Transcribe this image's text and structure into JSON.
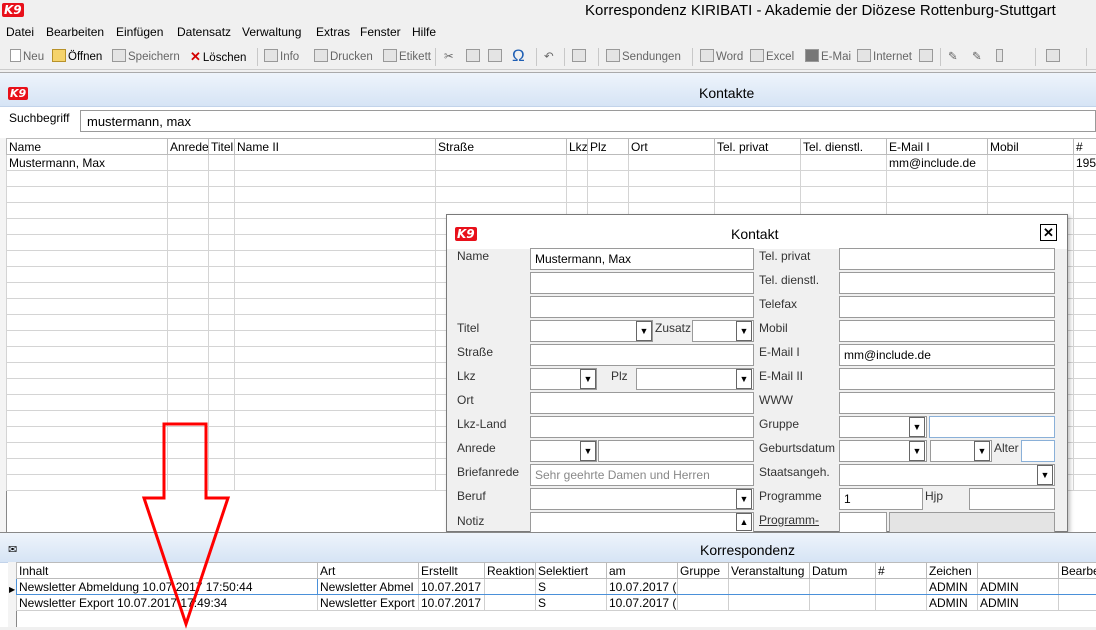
{
  "app": {
    "logo_text": "K9",
    "title": "Korrespondenz KIRIBATI - Akademie der Diözese Rottenburg-Stuttgart"
  },
  "menu": [
    "Datei",
    "Bearbeiten",
    "Einfügen",
    "Datensatz",
    "Verwaltung",
    "Extras",
    "Fenster",
    "Hilfe"
  ],
  "toolbar": {
    "neu": "Neu",
    "oeffnen": "Öffnen",
    "speichern": "Speichern",
    "loeschen": "Löschen",
    "info": "Info",
    "drucken": "Drucken",
    "etikett": "Etikett",
    "omega": "Ω",
    "sendungen": "Sendungen",
    "word": "Word",
    "excel": "Excel",
    "email": "E-Mai",
    "internet": "Internet"
  },
  "kontakte": {
    "title": "Kontakte",
    "search_label": "Suchbegriff",
    "search_value": "mustermann, max",
    "columns": [
      "Name",
      "Anrede",
      "Titel",
      "Name II",
      "Straße",
      "Lkz",
      "Plz",
      "Ort",
      "Tel. privat",
      "Tel. dienstl.",
      "E-Mail I",
      "Mobil",
      "#"
    ],
    "rows": [
      [
        "Mustermann, Max",
        "",
        "",
        "",
        "",
        "",
        "",
        "",
        "",
        "",
        "mm@include.de",
        "",
        "195"
      ]
    ]
  },
  "dialog": {
    "title": "Kontakt",
    "close": "✕",
    "labels": {
      "name": "Name",
      "titel": "Titel",
      "zusatz": "Zusatz",
      "strasse": "Straße",
      "lkz": "Lkz",
      "plz": "Plz",
      "ort": "Ort",
      "lkz_land": "Lkz-Land",
      "anrede": "Anrede",
      "briefanrede": "Briefanrede",
      "beruf": "Beruf",
      "notiz": "Notiz",
      "tel_privat": "Tel. privat",
      "tel_dienstl": "Tel. dienstl.",
      "telefax": "Telefax",
      "mobil": "Mobil",
      "email1": "E-Mail I",
      "email2": "E-Mail II",
      "www": "WWW",
      "gruppe": "Gruppe",
      "geburtsdatum": "Geburtsdatum",
      "alter": "Alter",
      "staatsangeh": "Staatsangeh.",
      "programme": "Programme",
      "hjp": "Hjp",
      "programm_fach": "Programm-"
    },
    "values": {
      "name": "Mustermann, Max",
      "email1": "mm@include.de",
      "programme": "1",
      "briefanrede_placeholder": "Sehr geehrte Damen und Herren"
    }
  },
  "korrespondenz": {
    "title": "Korrespondenz",
    "columns": [
      "Inhalt",
      "Art",
      "Erstellt",
      "Reaktion",
      "Selektiert",
      "am",
      "Gruppe",
      "Veranstaltung",
      "Datum",
      "#",
      "Zeichen",
      "",
      "Bearbe"
    ],
    "rows": [
      [
        "Newsletter Abmeldung 10.07.2017 17:50:44",
        "Newsletter Abmel",
        "10.07.2017",
        "",
        "S",
        "10.07.2017 (",
        "",
        "",
        "",
        "",
        "ADMIN",
        "ADMIN",
        ""
      ],
      [
        "Newsletter Export 10.07.2017 17:49:34",
        "Newsletter Export",
        "10.07.2017",
        "",
        "S",
        "10.07.2017 (",
        "",
        "",
        "",
        "",
        "ADMIN",
        "ADMIN",
        ""
      ]
    ]
  },
  "colors": {
    "accent_red": "#e8101a",
    "panel_blue": "#d6e4f5",
    "arrow": "#ff0000"
  }
}
